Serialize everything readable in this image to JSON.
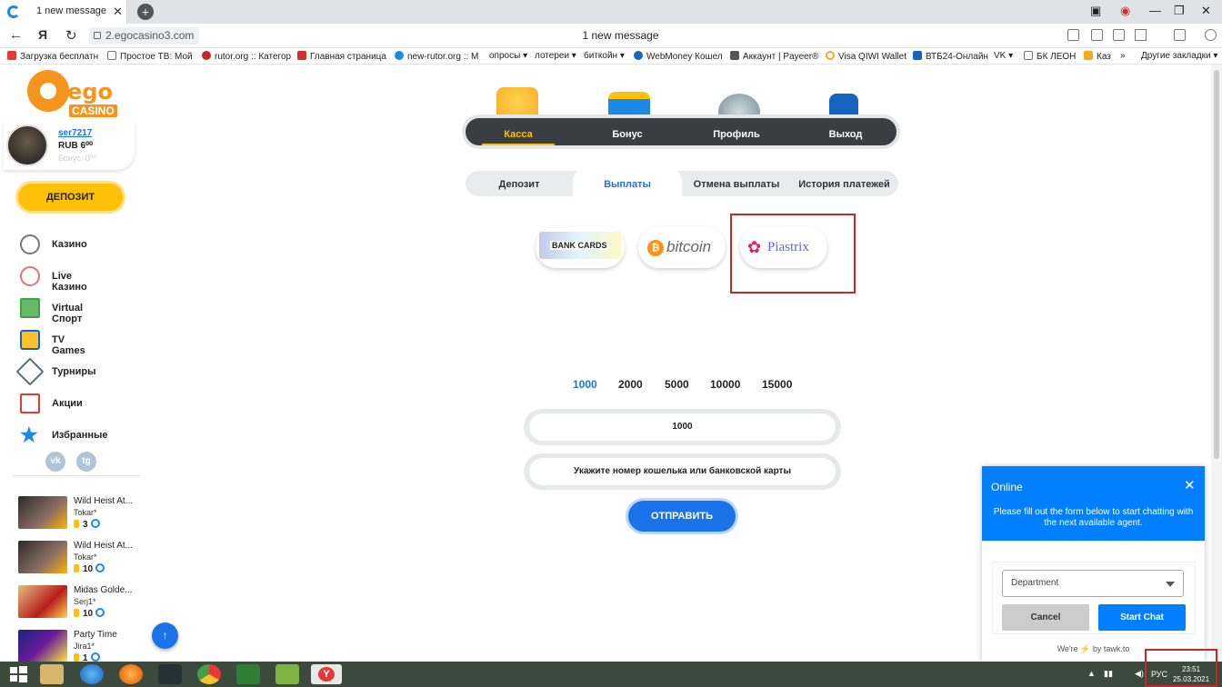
{
  "browser": {
    "tab_title": "1 new message",
    "new_tab": "+",
    "url": "2.egocasino3.com",
    "page_title": "1 new message",
    "bookmarks": [
      "Загрузка бесплатн",
      "Простое ТВ: Мой",
      "rutor.org :: Категор",
      "Главная страница",
      "new-rutor.org :: М",
      "опросы ▾",
      "лотереи ▾",
      "биткойн ▾",
      "WebMoney Кошел",
      "Аккаунт | Payeer®",
      "Visa QIWI Wallet",
      "ВТБ24-Онлайн",
      "VK ▾",
      "БК ЛЕОН",
      "Каз",
      "»",
      "Другие закладки ▾"
    ]
  },
  "sidebar": {
    "logo_text": "ego",
    "logo_sub": "CASINO",
    "username": "ser7217",
    "balance": "RUB 6⁰⁰",
    "bonus": "Бонус: 0⁰⁰",
    "deposit_label": "ДЕПОЗИТ",
    "menu": [
      "Казино",
      "Live Казино",
      "Virtual Спорт",
      "TV Games",
      "Турниры",
      "Акции",
      "Избранные"
    ],
    "social": [
      "vk",
      "tg"
    ],
    "games": [
      {
        "name": "Wild Heist At...",
        "user": "Tokar*",
        "count": "3"
      },
      {
        "name": "Wild Heist At...",
        "user": "Tokar*",
        "count": "10"
      },
      {
        "name": "Midas Golde...",
        "user": "Serj1*",
        "count": "10"
      },
      {
        "name": "Party Time",
        "user": "Jira1*",
        "count": "1"
      }
    ],
    "scroll_top": "↑"
  },
  "main": {
    "nav": [
      "Касса",
      "Бонус",
      "Профиль",
      "Выход"
    ],
    "subtabs": [
      "Депозит",
      "Выплаты",
      "Отмена выплаты",
      "История платежей"
    ],
    "payment_methods": [
      "BANK CARDS",
      "bitcoin",
      "Piastrix"
    ],
    "amounts": [
      "1000",
      "2000",
      "5000",
      "10000",
      "15000"
    ],
    "amount_value": "1000",
    "wallet_placeholder": "Укажите номер кошелька или банковской карты",
    "submit_label": "ОТПРАВИТЬ"
  },
  "chat": {
    "status": "Online",
    "close": "✕",
    "message": "Please fill out the form below to start chatting with the next available agent.",
    "department_placeholder": "Department",
    "cancel_label": "Cancel",
    "start_label": "Start Chat",
    "powered": "We're ⚡ by tawk.to"
  },
  "taskbar": {
    "lang": "РУС",
    "time": "23:51",
    "date": "25.03.2021"
  },
  "colors": {
    "accent": "#1a73e8",
    "brand": "#f7941d",
    "deposit": "#ffc107",
    "highlight": "#c62828"
  }
}
